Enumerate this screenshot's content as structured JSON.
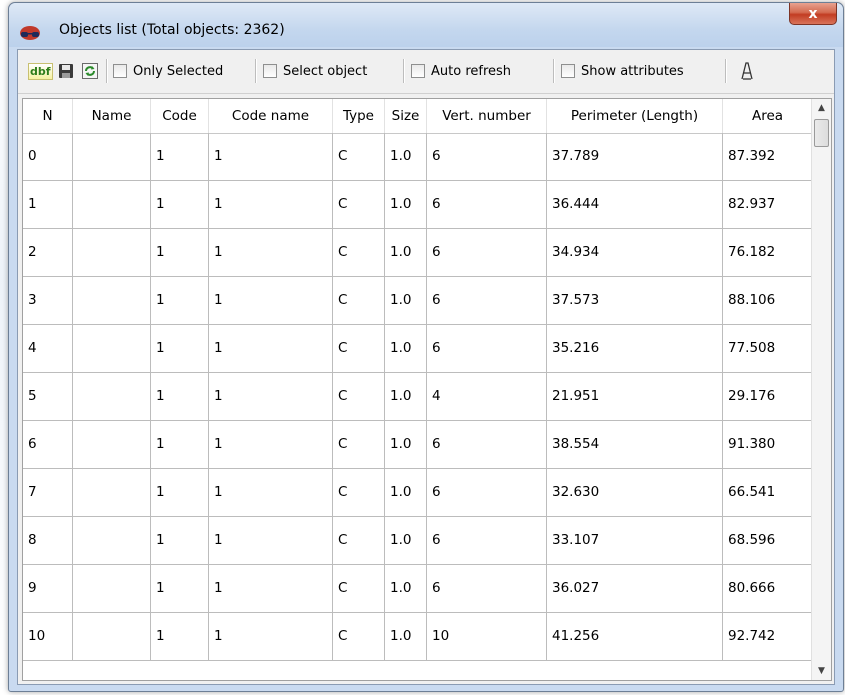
{
  "window": {
    "title": "Objects list (Total objects: 2362)",
    "close_label": "x"
  },
  "toolbar": {
    "dbf_label": "dbf",
    "only_selected_label": "Only Selected",
    "select_object_label": "Select object",
    "auto_refresh_label": "Auto refresh",
    "show_attributes_label": "Show attributes",
    "only_selected_checked": false,
    "select_object_checked": false,
    "auto_refresh_checked": false,
    "show_attributes_checked": false
  },
  "table": {
    "columns": [
      "N",
      "Name",
      "Code",
      "Code name",
      "Type",
      "Size",
      "Vert. number",
      "Perimeter (Length)",
      "Area"
    ],
    "rows": [
      [
        "0",
        "",
        "1",
        "1",
        "C",
        "1.0",
        "6",
        "37.789",
        "87.392"
      ],
      [
        "1",
        "",
        "1",
        "1",
        "C",
        "1.0",
        "6",
        "36.444",
        "82.937"
      ],
      [
        "2",
        "",
        "1",
        "1",
        "C",
        "1.0",
        "6",
        "34.934",
        "76.182"
      ],
      [
        "3",
        "",
        "1",
        "1",
        "C",
        "1.0",
        "6",
        "37.573",
        "88.106"
      ],
      [
        "4",
        "",
        "1",
        "1",
        "C",
        "1.0",
        "6",
        "35.216",
        "77.508"
      ],
      [
        "5",
        "",
        "1",
        "1",
        "C",
        "1.0",
        "4",
        "21.951",
        "29.176"
      ],
      [
        "6",
        "",
        "1",
        "1",
        "C",
        "1.0",
        "6",
        "38.554",
        "91.380"
      ],
      [
        "7",
        "",
        "1",
        "1",
        "C",
        "1.0",
        "6",
        "32.630",
        "66.541"
      ],
      [
        "8",
        "",
        "1",
        "1",
        "C",
        "1.0",
        "6",
        "33.107",
        "68.596"
      ],
      [
        "9",
        "",
        "1",
        "1",
        "C",
        "1.0",
        "6",
        "36.027",
        "80.666"
      ],
      [
        "10",
        "",
        "1",
        "1",
        "C",
        "1.0",
        "10",
        "41.256",
        "92.742"
      ]
    ]
  }
}
